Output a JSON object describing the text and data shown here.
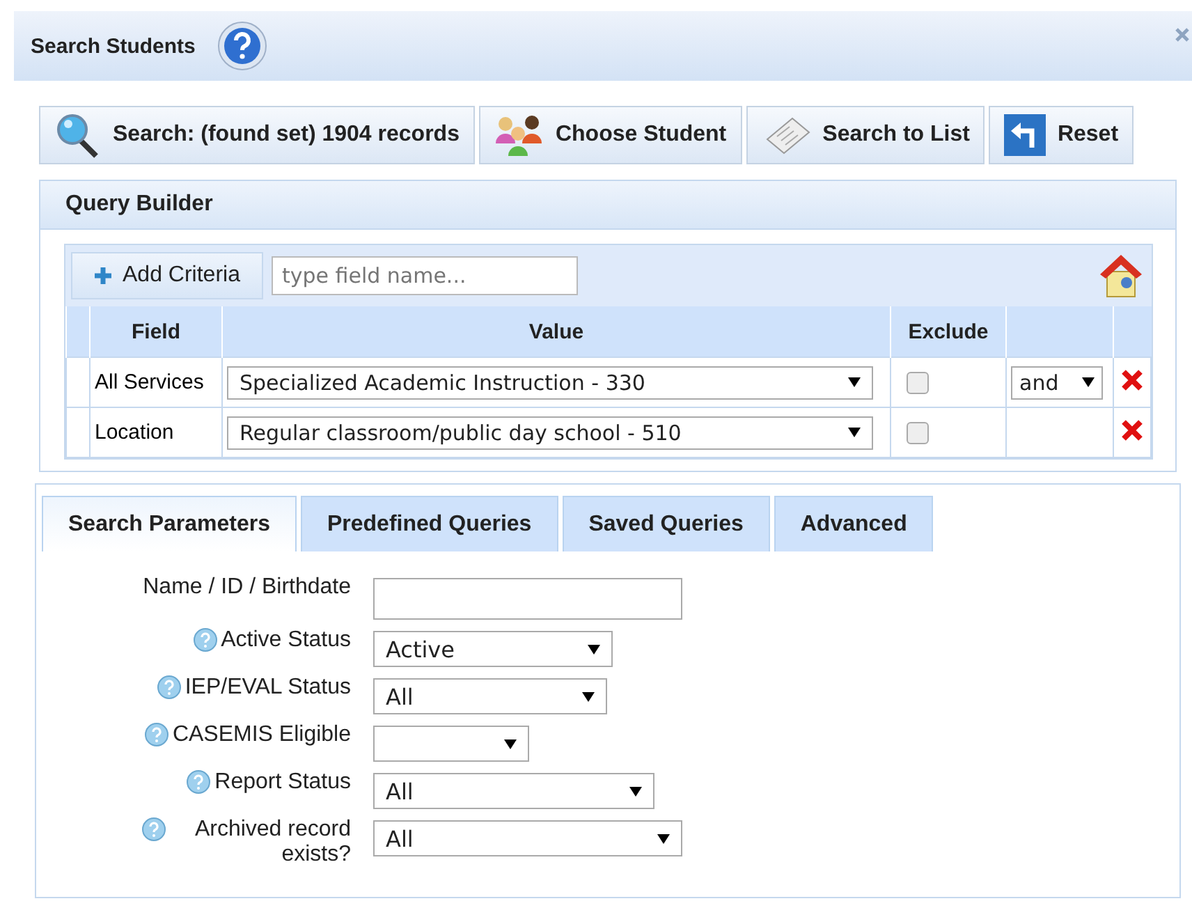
{
  "window": {
    "title": "Search Students"
  },
  "toolbar": [
    {
      "kind": "search",
      "label": "Search: (found set) 1904 records"
    },
    {
      "kind": "people",
      "label": "Choose Student"
    },
    {
      "kind": "list",
      "label": "Search to List"
    },
    {
      "kind": "reset",
      "label": "Reset"
    }
  ],
  "query_builder": {
    "title": "Query Builder",
    "add_button": "Add Criteria",
    "field_search": {
      "placeholder": "type field name..."
    },
    "columns": [
      "Field",
      "Value",
      "Exclude"
    ],
    "rows": [
      {
        "field": "All Services",
        "value": "Specialized Academic Instruction - 330",
        "exclude": false,
        "conjunction": "and"
      },
      {
        "field": "Location",
        "value": "Regular classroom/public day school - 510",
        "exclude": false
      }
    ]
  },
  "tabs": [
    {
      "label": "Search Parameters",
      "selected": true
    },
    {
      "label": "Predefined Queries",
      "selected": false
    },
    {
      "label": "Saved Queries",
      "selected": false
    },
    {
      "label": "Advanced",
      "selected": false
    }
  ],
  "parameters": [
    {
      "kind": "text",
      "label": "Name / ID / Birthdate",
      "help": false
    },
    {
      "kind": "select",
      "label": "Active Status",
      "help": true,
      "value": "Active"
    },
    {
      "kind": "select",
      "label": "IEP/EVAL Status",
      "help": true,
      "value": "All"
    },
    {
      "kind": "select",
      "label": "CASEMIS Eligible",
      "help": true
    },
    {
      "kind": "select",
      "label": "Report Status",
      "help": true,
      "value": "All"
    },
    {
      "kind": "select",
      "label": "Archived record exists?",
      "help": true,
      "value": "All"
    }
  ]
}
